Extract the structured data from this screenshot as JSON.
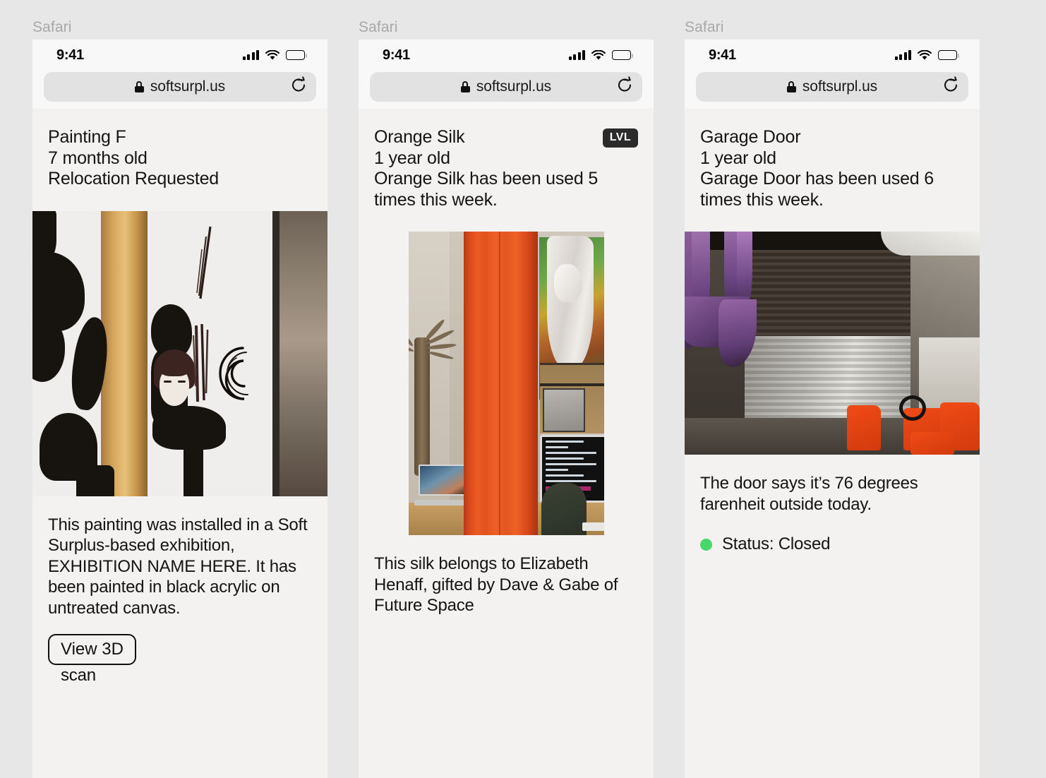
{
  "page": {
    "background": "#e7e7e7",
    "screen_background": "#f4f2f0"
  },
  "browser": {
    "app_label": "Safari",
    "status_bar": {
      "time": "9:41",
      "cellular_icon": "signal-bars-icon",
      "wifi_icon": "wifi-icon",
      "battery_icon": "battery-icon"
    },
    "url_bar": {
      "lock_icon": "lock-icon",
      "url": "softsurpl.us",
      "reload_icon": "reload-icon"
    }
  },
  "panels": [
    {
      "title": "Painting F",
      "age": "7 months old",
      "status_line": "Relocation Requested",
      "badge": null,
      "image": {
        "name": "painting-photo",
        "alt": "Abstract black brushstroke painting on white canvas behind a wooden post"
      },
      "description": "This painting was installed in a Soft Surplus-based exhibition, EXHIBITION NAME HERE. It has been painted in black acrylic on untreated canvas.",
      "button_label": "View 3D",
      "button_overflow_label": "scan",
      "weather_line": null,
      "status_badge": null
    },
    {
      "title": "Orange Silk",
      "age": "1 year old",
      "status_line": "Orange Silk has been used 5 times this week.",
      "badge": "LVL",
      "badge_color": "#2b2b2b",
      "image": {
        "name": "orange-silk-photo",
        "alt": "Orange silk fabric hanging in a studio workspace with desks and monitors"
      },
      "description": "This silk belongs to Elizabeth Henaff, gifted by Dave & Gabe of Future Space",
      "button_label": null,
      "button_overflow_label": null,
      "weather_line": null,
      "status_badge": null
    },
    {
      "title": "Garage Door",
      "age": "1 year old",
      "status_line": "Garage Door has been used 6 times this week.",
      "badge": null,
      "image": {
        "name": "garage-door-photo",
        "alt": "Closed metal garage door with purple silk draped at left and orange chairs at right"
      },
      "description": null,
      "button_label": null,
      "button_overflow_label": null,
      "weather_line": "The door says it’s 76 degrees farenheit outside today.",
      "status_badge": {
        "label": "Status: Closed",
        "dot_color": "#4ad66d"
      }
    }
  ]
}
